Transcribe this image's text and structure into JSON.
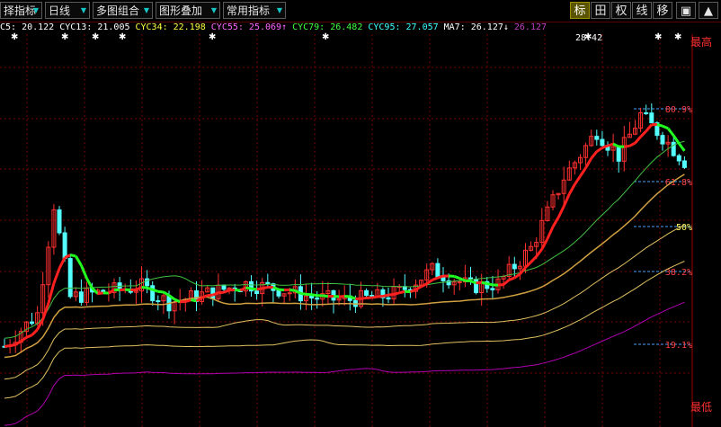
{
  "toolbar": {
    "left_buttons": [
      {
        "label": "择指标",
        "has_dropdown": true
      },
      {
        "label": "日线",
        "has_dropdown": true
      },
      {
        "label": "多图组合",
        "has_dropdown": true
      },
      {
        "label": "图形叠加",
        "has_dropdown": true
      },
      {
        "label": "常用指标",
        "has_dropdown": true
      }
    ],
    "right_buttons": [
      {
        "label": "标",
        "active": true
      },
      {
        "label": "田",
        "active": false
      },
      {
        "label": "权",
        "active": false
      },
      {
        "label": "线",
        "active": false
      },
      {
        "label": "移",
        "active": false
      },
      {
        "label": "▣",
        "active": false
      },
      {
        "label": "▲",
        "active": false
      }
    ]
  },
  "legend": [
    {
      "text": "C5: 20.122",
      "color": "#ffffff"
    },
    {
      "text": "CYC13: 21.005",
      "color": "#ffffff"
    },
    {
      "text": "CYC34: 22.198",
      "color": "#ffff40"
    },
    {
      "text": "CYC55: 25.069↑",
      "color": "#ff66ff"
    },
    {
      "text": "CYC79: 26.482",
      "color": "#40ff40"
    },
    {
      "text": "CYC95: 27.057",
      "color": "#40ffff"
    },
    {
      "text": "MA7: 26.127↓",
      "color": "#ffffff"
    },
    {
      "text": "26.127",
      "color": "#c040c0"
    }
  ],
  "annotations": {
    "high_price": "28.42",
    "high_label": "最高",
    "low_label": "最低"
  },
  "fib_levels": [
    {
      "label": "80.9%",
      "value": 0.809
    },
    {
      "label": "61.8%",
      "value": 0.618
    },
    {
      "label": "50%",
      "value": 0.5
    },
    {
      "label": "38.2%",
      "value": 0.382
    },
    {
      "label": "19.1%",
      "value": 0.191
    }
  ],
  "colors": {
    "background": "#000000",
    "grid": "#7a0000",
    "up_candle": "#ff3030",
    "down_candle": "#54ffff",
    "accent_toolbar": "#5a5400"
  },
  "chart_data": {
    "type": "candlestick",
    "title": "",
    "price_range": [
      15,
      29
    ],
    "high": 28.42,
    "series": [
      {
        "name": "C5",
        "last": 20.122
      },
      {
        "name": "CYC13",
        "last": 21.005
      },
      {
        "name": "CYC34",
        "last": 22.198
      },
      {
        "name": "CYC55",
        "last": 25.069
      },
      {
        "name": "CYC79",
        "last": 26.482
      },
      {
        "name": "CYC95",
        "last": 27.057
      },
      {
        "name": "MA7",
        "last": 26.127
      }
    ]
  }
}
